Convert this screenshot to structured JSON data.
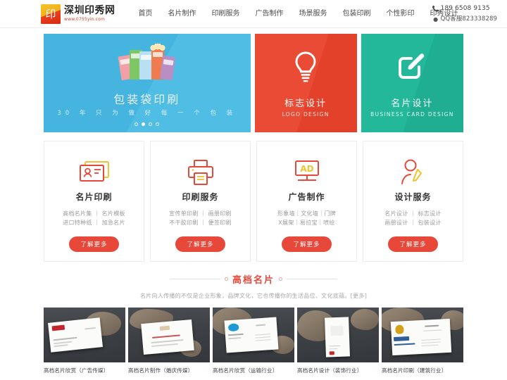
{
  "header": {
    "logo": {
      "title": "深圳印秀网",
      "url": "www.0755yin.com",
      "glyph": "印"
    },
    "nav": [
      {
        "label": "首页",
        "name": "nav-home"
      },
      {
        "label": "名片制作",
        "name": "nav-business-card"
      },
      {
        "label": "印刷服务",
        "name": "nav-printing-service"
      },
      {
        "label": "广告制作",
        "name": "nav-advertising"
      },
      {
        "label": "场景服务",
        "name": "nav-scene-service"
      },
      {
        "label": "包装印刷",
        "name": "nav-package-printing"
      },
      {
        "label": "个性影印",
        "name": "nav-personal-copy"
      },
      {
        "label": "印秀设计",
        "name": "nav-yinxiu-design"
      }
    ],
    "contact": {
      "phone_icon": "phone-icon",
      "phone": "189 6508 9135",
      "qq_icon": "qq-icon",
      "qq": "QQ客服823338289"
    }
  },
  "hero": {
    "title": "包装袋印刷",
    "subtitle": "30 年 只 为 做 好 每 一 个 包 装",
    "dots": 4,
    "active_dot": 1
  },
  "promos": [
    {
      "cn": "标志设计",
      "en": "LOGO DESIGN",
      "icon": "lightbulb-icon",
      "color": "#e94b35"
    },
    {
      "cn": "名片设计",
      "en": "BUSINESS CARD DESIGN",
      "icon": "edit-pencil-icon",
      "color": "#23b89a"
    }
  ],
  "cards": [
    {
      "title": "名片印刷",
      "icon": "id-card-icon",
      "links": [
        "高档名片集 ｜ 名片模板",
        "进口特种纸 ｜ 加急名片"
      ],
      "button": "了解更多"
    },
    {
      "title": "印刷服务",
      "icon": "printer-icon",
      "links": [
        "宣传单印刷 ｜ 画册印刷",
        "不干胶印刷 ｜ 便签印刷"
      ],
      "button": "了解更多"
    },
    {
      "title": "广告制作",
      "icon": "ad-board-icon",
      "links": [
        "形象墙｜文化墙｜门牌",
        "X展架｜易拉宝｜喷绘"
      ],
      "button": "了解更多"
    },
    {
      "title": "设计服务",
      "icon": "person-pencil-icon",
      "links": [
        "名片设计 ｜ 标志设计",
        "画册设计 ｜ 包装设计"
      ],
      "button": "了解更多"
    }
  ],
  "section": {
    "title": "高档名片",
    "subtitle": "名片向人传播的不仅是企业形象，品牌文化，它也传播你的生活品位、文化底蕴。[更多]"
  },
  "gallery": [
    {
      "caption": "高档名片欣赏（广告传媒）"
    },
    {
      "caption": "高档名片制作（婚庆传媒）"
    },
    {
      "caption": "高档名片欣赏（运输行业）"
    },
    {
      "caption": "高档名片设计（装饰行业）"
    },
    {
      "caption": "高档名片印刷（建筑行业）"
    }
  ],
  "theme": {
    "accent": "#e8483a",
    "hero_blue": "#45b4de",
    "promo_red": "#e94b35",
    "promo_teal": "#23b89a"
  }
}
